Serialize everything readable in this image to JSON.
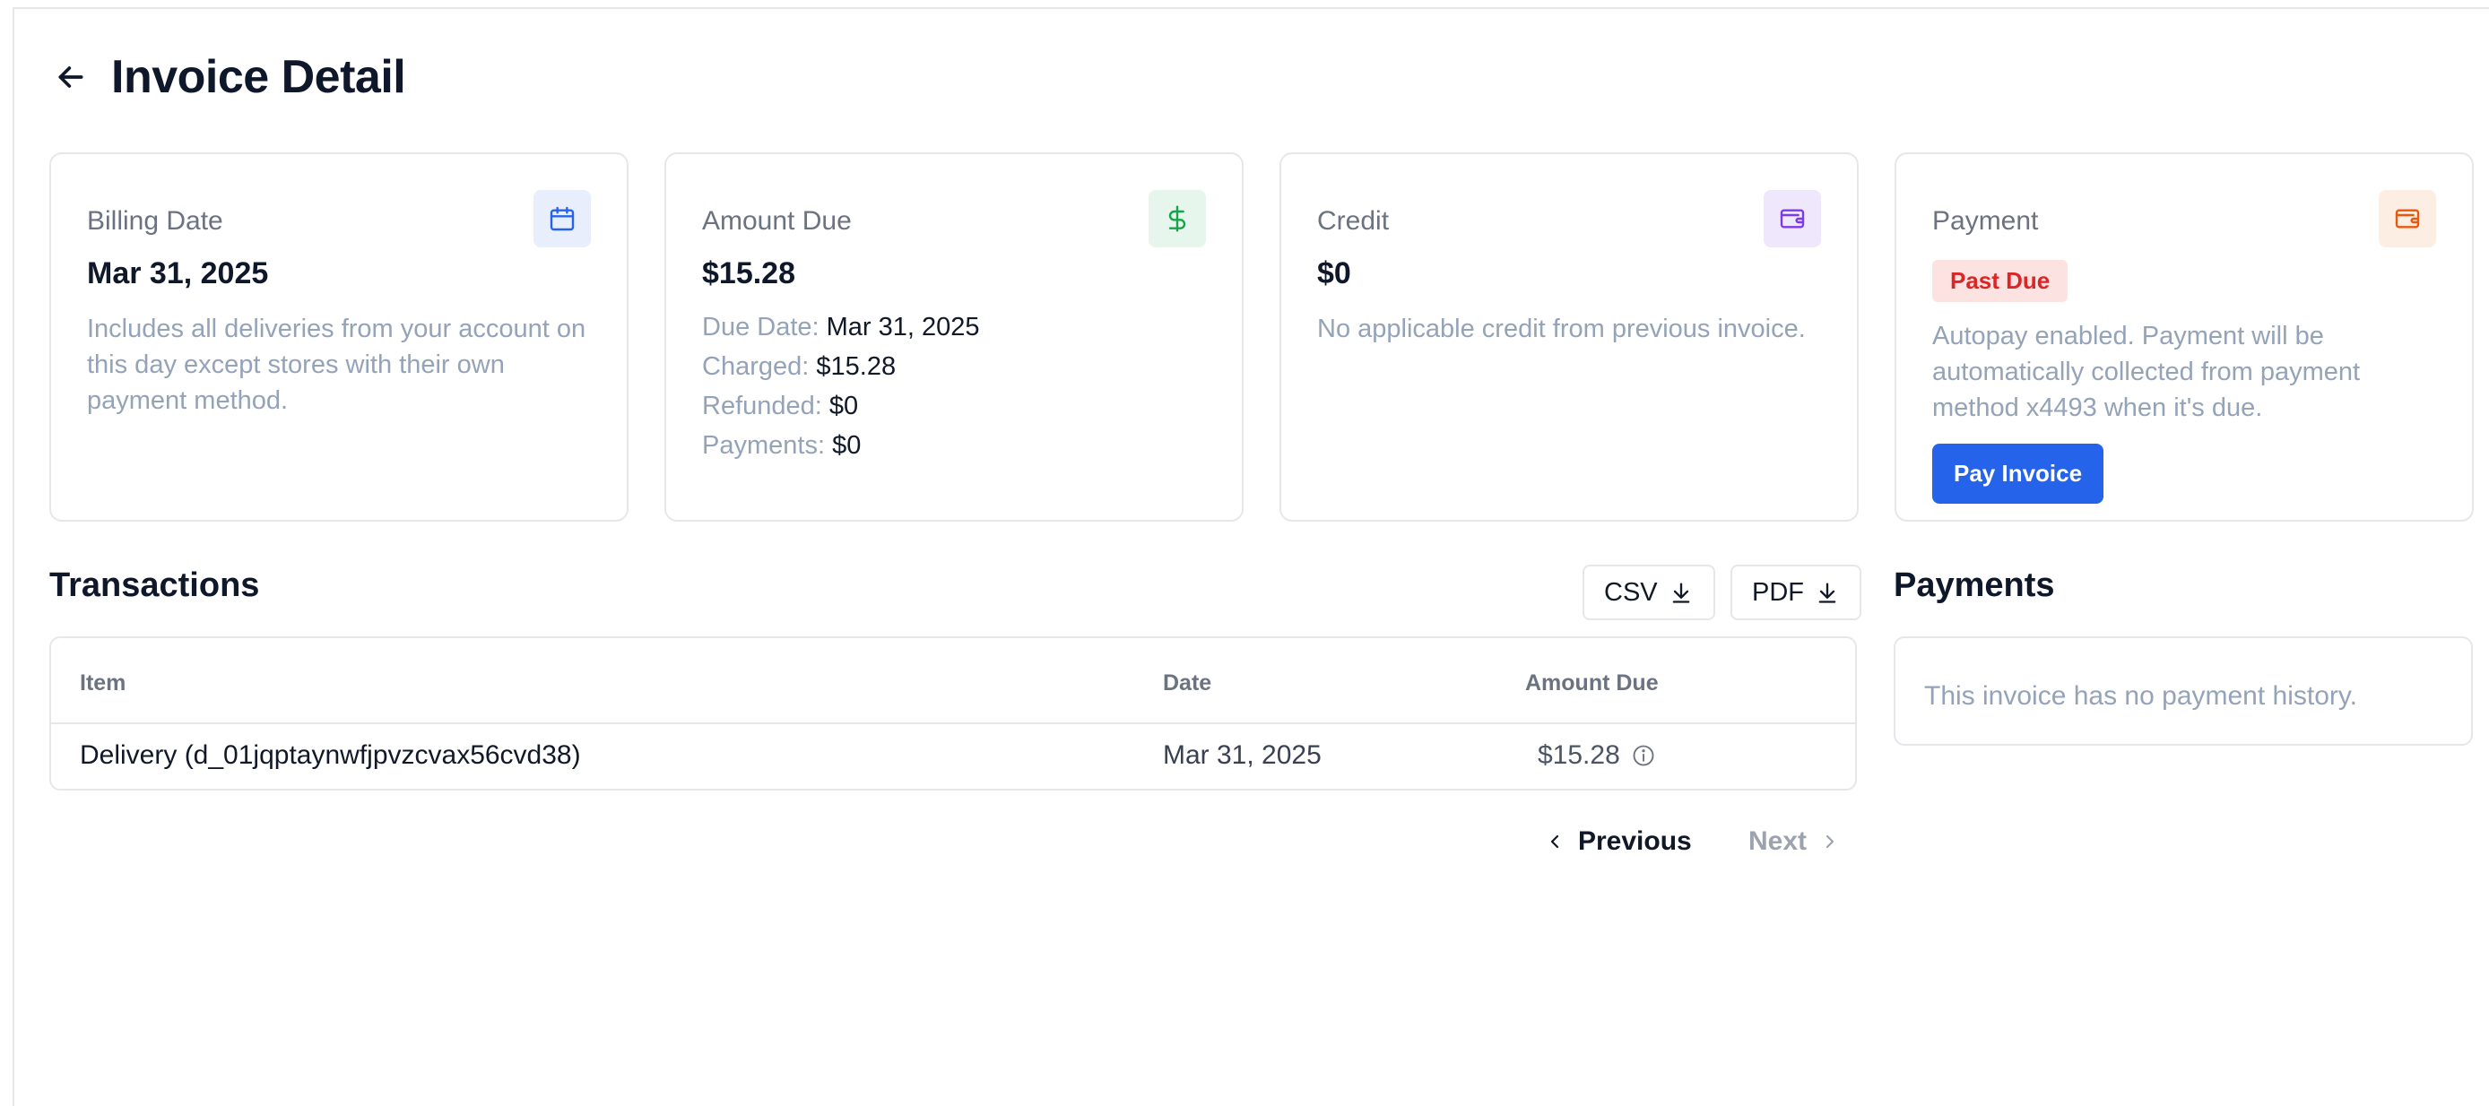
{
  "page": {
    "title": "Invoice Detail"
  },
  "cards": {
    "billing": {
      "label": "Billing Date",
      "value": "Mar 31, 2025",
      "description": "Includes all deliveries from your account on this day except stores with their own payment method.",
      "icon": "calendar-icon",
      "icon_color": "#2563eb",
      "icon_bg": "#e8eefc"
    },
    "amount": {
      "label": "Amount Due",
      "value": "$15.28",
      "icon": "dollar-icon",
      "icon_color": "#16a34a",
      "icon_bg": "#e6f6ec",
      "lines": [
        {
          "key": "Due Date:",
          "val": "Mar 31, 2025"
        },
        {
          "key": "Charged:",
          "val": "$15.28"
        },
        {
          "key": "Refunded:",
          "val": "$0"
        },
        {
          "key": "Payments:",
          "val": "$0"
        }
      ]
    },
    "credit": {
      "label": "Credit",
      "value": "$0",
      "description": "No applicable credit from previous invoice.",
      "icon": "wallet-icon",
      "icon_color": "#7c3aed",
      "icon_bg": "#efe7fb"
    },
    "payment": {
      "label": "Payment",
      "badge": "Past Due",
      "description": "Autopay enabled. Payment will be automatically collected from payment method x4493 when it's due.",
      "button": "Pay Invoice",
      "icon": "wallet-icon",
      "icon_color": "#ea580c",
      "icon_bg": "#fdeee3"
    }
  },
  "transactions": {
    "title": "Transactions",
    "csv_label": "CSV",
    "pdf_label": "PDF",
    "columns": {
      "item": "Item",
      "date": "Date",
      "amount": "Amount Due"
    },
    "rows": [
      {
        "item": "Delivery (d_01jqptaynwfjpvzcvax56cvd38)",
        "date": "Mar 31, 2025",
        "amount": "$15.28"
      }
    ],
    "pager": {
      "previous": "Previous",
      "next": "Next"
    }
  },
  "payments": {
    "title": "Payments",
    "empty": "This invoice has no payment history."
  }
}
